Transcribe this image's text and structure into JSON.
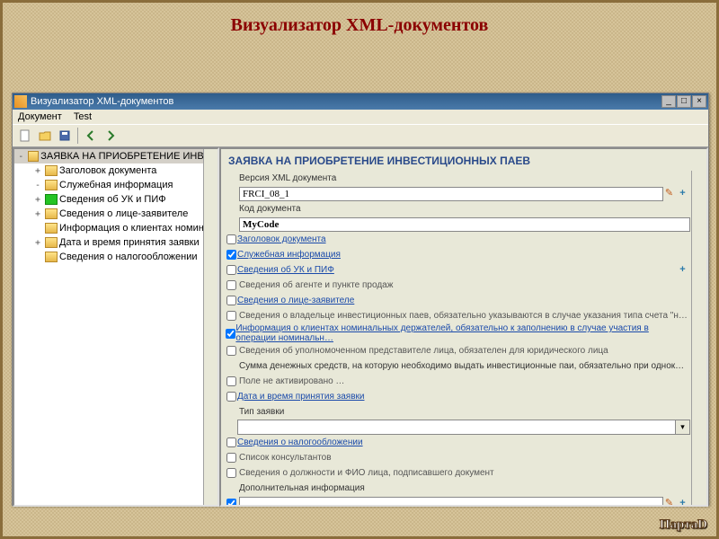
{
  "page_title": "Визуализатор XML-документов",
  "window": {
    "title": "Визуализатор XML-документов",
    "menu": {
      "doc": "Документ",
      "test": "Test"
    }
  },
  "tree": {
    "root": "ЗАЯВКА НА ПРИОБРЕТЕНИЕ ИНВЕС",
    "items": [
      {
        "label": "Заголовок документа",
        "twist": "+",
        "icon": "fold"
      },
      {
        "label": "Служебная информация",
        "twist": "-",
        "icon": "fold"
      },
      {
        "label": "Сведения об УК и ПИФ",
        "twist": "+",
        "icon": "green"
      },
      {
        "label": "Сведения о лице-заявителе",
        "twist": "+",
        "icon": "fold"
      },
      {
        "label": "Информация о клиентах номинал",
        "twist": "",
        "icon": "fold"
      },
      {
        "label": "Дата и время принятия заявки",
        "twist": "+",
        "icon": "fold"
      },
      {
        "label": "Сведения о налогообложении",
        "twist": "",
        "icon": "fold"
      }
    ]
  },
  "form": {
    "title": "ЗАЯВКА НА ПРИОБРЕТЕНИЕ ИНВЕСТИЦИОННЫХ ПАЕВ",
    "rows": [
      {
        "type": "label",
        "text": "Версия XML документа"
      },
      {
        "type": "input",
        "value": "FRCI_08_1",
        "icons": [
          "edit",
          "plus"
        ]
      },
      {
        "type": "label",
        "text": "Код документа"
      },
      {
        "type": "input",
        "value": "MyCode",
        "bold": true
      },
      {
        "type": "cblink",
        "checked": false,
        "text": "Заголовок документа"
      },
      {
        "type": "cblink",
        "checked": true,
        "text": "Служебная информация"
      },
      {
        "type": "cblink",
        "checked": false,
        "text": "Сведения об УК и ПИФ",
        "icons": [
          "plus"
        ]
      },
      {
        "type": "cblabel",
        "checked": false,
        "text": "Сведения об агенте и пункте продаж"
      },
      {
        "type": "cblink",
        "checked": false,
        "text": "Сведения о лице-заявителе"
      },
      {
        "type": "cblabel",
        "checked": false,
        "text": "Сведения о владельце инвестиционных паев, обязательно указываются в случае указания типа счета \"номинальный де…"
      },
      {
        "type": "cblink",
        "checked": true,
        "text": "Информация о клиентах номинальных держателей, обязательно к заполнению в случае участия в операции номинальн…"
      },
      {
        "type": "cblabel",
        "checked": false,
        "text": "Сведения об уполномоченном представителе лица,  обязателен для юридического лица"
      },
      {
        "type": "label",
        "text": "Сумма денежных средств, на которую необходимо выдать инвестиционные паи, обязательно при однократной заявке"
      },
      {
        "type": "cblabel",
        "checked": false,
        "text": "Поле не активировано …"
      },
      {
        "type": "cblink",
        "checked": false,
        "text": "Дата и время принятия заявки"
      },
      {
        "type": "label",
        "text": "Тип заявки"
      },
      {
        "type": "dropdown",
        "value": ""
      },
      {
        "type": "cblink",
        "checked": false,
        "text": "Сведения о налогообложении"
      },
      {
        "type": "cblabel",
        "checked": false,
        "text": "Список консультантов"
      },
      {
        "type": "cblabel",
        "checked": false,
        "text": "Сведения о должности и ФИО лица, подписавшего документ"
      },
      {
        "type": "label",
        "text": "Дополнительная информация"
      },
      {
        "type": "cbinput",
        "checked": true,
        "value": "",
        "icons": [
          "edit",
          "plus"
        ]
      }
    ]
  },
  "brand": "ПартаD"
}
